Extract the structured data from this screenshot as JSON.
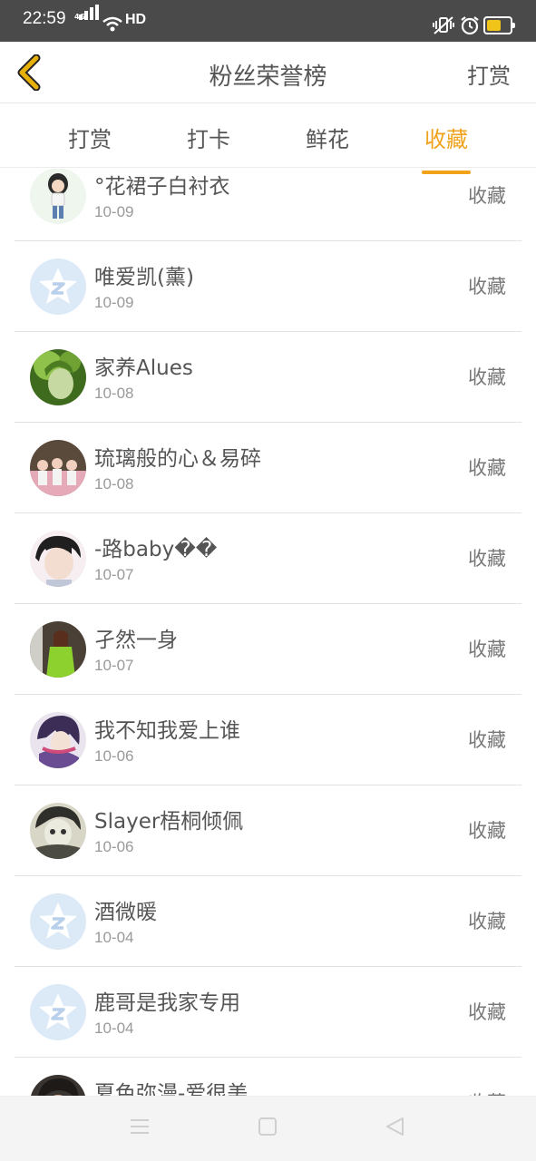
{
  "status_bar": {
    "time": "22:59",
    "network": "4G",
    "hd": "HD",
    "battery_color": "#f0c419"
  },
  "header": {
    "title": "粉丝荣誉榜",
    "right_action": "打赏",
    "back_icon": "chevron-left-icon",
    "accent": "#e8b10a"
  },
  "tabs": [
    {
      "label": "打赏",
      "active": false
    },
    {
      "label": "打卡",
      "active": false
    },
    {
      "label": "鲜花",
      "active": false
    },
    {
      "label": "收藏",
      "active": true
    }
  ],
  "accent_color": "#f0a21b",
  "items": [
    {
      "name": "°花裙子白衬衣",
      "date": "10-09",
      "action": "收藏",
      "avatar": "cartoon-girl-avatar"
    },
    {
      "name": "唯爱凯(薰)",
      "date": "10-09",
      "action": "收藏",
      "avatar": "default-qq-avatar"
    },
    {
      "name": "家养Alues",
      "date": "10-08",
      "action": "收藏",
      "avatar": "green-photo-avatar"
    },
    {
      "name": "琉璃般的心＆易碎",
      "date": "10-08",
      "action": "收藏",
      "avatar": "group-photo-avatar"
    },
    {
      "name": "-路baby��",
      "date": "10-07",
      "action": "收藏",
      "avatar": "boy-photo-avatar"
    },
    {
      "name": "孑然一身",
      "date": "10-07",
      "action": "收藏",
      "avatar": "girl-green-avatar"
    },
    {
      "name": "我不知我爱上谁",
      "date": "10-06",
      "action": "收藏",
      "avatar": "anime-avatar"
    },
    {
      "name": "Slayer梧桐倾佩",
      "date": "10-06",
      "action": "收藏",
      "avatar": "sketch-avatar"
    },
    {
      "name": "酒微暖",
      "date": "10-04",
      "action": "收藏",
      "avatar": "default-qq-avatar"
    },
    {
      "name": "鹿哥是我家专用",
      "date": "10-04",
      "action": "收藏",
      "avatar": "default-qq-avatar"
    },
    {
      "name": "夏色弥漫-爱很美",
      "date": "",
      "action": "收藏",
      "avatar": "dark-photo-avatar"
    }
  ],
  "navbar": {
    "menu_icon": "menu-icon",
    "home_icon": "home-square-icon",
    "back_icon": "back-triangle-icon"
  }
}
